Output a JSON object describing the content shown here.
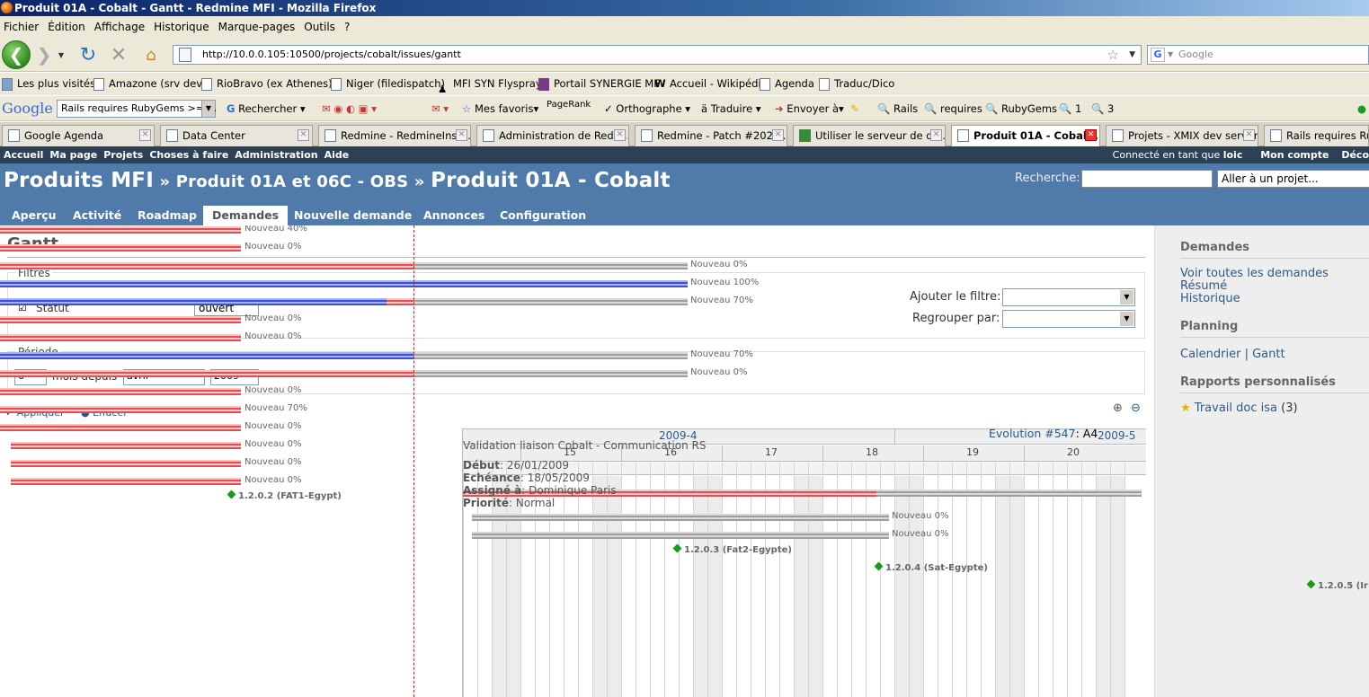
{
  "window": {
    "title": "Produit 01A - Cobalt - Gantt - Redmine MFI - Mozilla Firefox"
  },
  "menubar": [
    "Fichier",
    "Édition",
    "Affichage",
    "Historique",
    "Marque-pages",
    "Outils",
    "?"
  ],
  "nav": {
    "url": "http://10.0.0.105:10500/projects/cobalt/issues/gantt",
    "search_placeholder": "Google"
  },
  "bookmarks": [
    "Les plus visités",
    "Amazone (srv dev)",
    "RioBravo (ex Athenes)",
    "Niger (filedispatch)",
    "MFI SYN Flyspray",
    "Portail SYNERGIE MF",
    "Accueil - Wikipédia",
    "Agenda",
    "Traduc/Dico"
  ],
  "google_bar": {
    "logo": "Google",
    "query": "Rails requires RubyGems >= 1.",
    "search": "Rechercher",
    "favoris": "Mes favoris",
    "pagerank": "PageRank",
    "ortho": "Orthographe",
    "traduire": "Traduire",
    "envoyer": "Envoyer à",
    "items": [
      "Rails",
      "requires",
      "RubyGems",
      "1",
      "3"
    ]
  },
  "tabs": [
    "Google Agenda",
    "Data Center",
    "Redmine - RedmineInst...",
    "Administration de Redm...",
    "Redmine - Patch #2024...",
    "Utiliser le serveur de dé...",
    "Produit 01A - Cobal...",
    "Projets - XMIX dev server",
    "Rails requires Ruby"
  ],
  "topmenu": {
    "left": [
      "Accueil",
      "Ma page",
      "Projets",
      "Choses à faire",
      "Administration",
      "Aide"
    ],
    "connected_prefix": "Connecté en tant que ",
    "user": "loic",
    "account": "Mon compte",
    "logout": "Déco"
  },
  "header": {
    "root": "Produits MFI",
    "parent": "Produit 01A et 06C - OBS",
    "project": "Produit 01A - Cobalt",
    "sep": " » ",
    "search_label": "Recherche:",
    "jump": "Aller à un projet..."
  },
  "mainmenu": [
    "Aperçu",
    "Activité",
    "Roadmap",
    "Demandes",
    "Nouvelle demande",
    "Annonces",
    "Configuration"
  ],
  "content": {
    "title": "Gantt",
    "filters_legend": "Filtres",
    "status_label": "Statut",
    "status_value": "ouvert",
    "add_filter": "Ajouter le filtre:",
    "group_by": "Regrouper par:",
    "period_legend": "Période",
    "months": "6",
    "months_from": "mois depuis",
    "month": "avril",
    "year": "2009",
    "apply": "Appliquer",
    "clear": "Effacer"
  },
  "bars_left": [
    {
      "label": "Nouveau 40%"
    },
    {
      "label": "Nouveau 0%"
    },
    {
      "label": "Nouveau 0%"
    },
    {
      "label": "Nouveau 100%"
    },
    {
      "label": "Nouveau 70%"
    },
    {
      "label": "Nouveau 0%"
    },
    {
      "label": "Nouveau 0%"
    },
    {
      "label": "Nouveau 70%"
    },
    {
      "label": "Nouveau 0%"
    },
    {
      "label": "Nouveau 0%"
    },
    {
      "label": "Nouveau 70%"
    },
    {
      "label": "Nouveau 0%"
    },
    {
      "label": "Nouveau 0%"
    },
    {
      "label": "Nouveau 0%"
    },
    {
      "label": "Nouveau 0%"
    }
  ],
  "gantt": {
    "month1": "2009-4",
    "month2": "2009-5",
    "weeks": [
      "15",
      "16",
      "17",
      "18",
      "19",
      "20"
    ],
    "issue_link": "Evolution #547",
    "issue_suffix": ": A4",
    "tooltip": {
      "title": "Validation liaison Cobalt - Communication RS",
      "start_label": "Début",
      "start": "26/01/2009",
      "due_label": "Echéance",
      "due": "18/05/2009",
      "assigned_label": "Assigné à",
      "assigned": "Dominique Paris",
      "priority_label": "Priorité",
      "priority": "Normal"
    },
    "bar_labels": [
      "Nouveau 0%",
      "Nouveau 0%"
    ],
    "milestones": [
      "1.2.0.2 (FAT1-Egypt)",
      "1.2.0.3 (Fat2-Egypte)",
      "1.2.0.4 (Sat-Egypte)",
      "1.2.0.5 (Ir"
    ]
  },
  "sidebar": {
    "h1": "Demandes",
    "links1": [
      "Voir toutes les demandes",
      "Résumé",
      "Historique"
    ],
    "h2": "Planning",
    "cal": "Calendrier",
    "gantt": "Gantt",
    "sep": " | ",
    "h3": "Rapports personnalisés",
    "report": "Travail doc isa",
    "report_count": "(3)"
  },
  "colors": {
    "header": "#507aaa",
    "topmenu": "#2c4056",
    "late": "#e05050",
    "done": "#3c4fd0",
    "todo": "#9e9e9e",
    "milestone": "#1a9a1a"
  }
}
